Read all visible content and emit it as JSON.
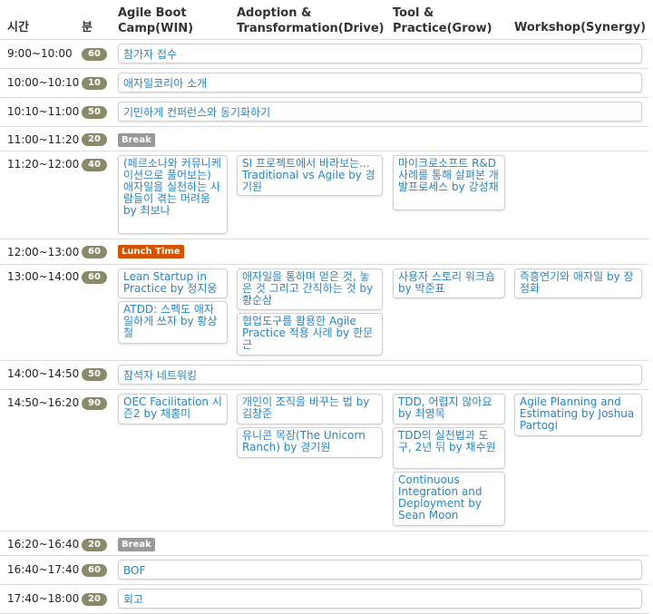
{
  "colors": {
    "badge": "#8a8a6a",
    "link": "#2a85c2",
    "break_tag": "#999999",
    "lunch_tag": "#d35400",
    "border": "#d0d0d0"
  },
  "header": {
    "time": "시간",
    "minutes": "분",
    "tracks": [
      "Agile Boot\nCamp(WIN)",
      "Adoption &\nTransformation(Drive)",
      "Tool &\nPractice(Grow)",
      "Workshop(Synergy)"
    ]
  },
  "rows": [
    {
      "time": "9:00~10:00",
      "min": "60",
      "text": "참가자 접수"
    },
    {
      "time": "10:00~10:10",
      "min": "10",
      "text": "애자일코리아 소개"
    },
    {
      "time": "10:10~11:00",
      "min": "50",
      "text": "기민하게 컨퍼런스와 동기화하기"
    },
    {
      "time": "11:00~11:20",
      "min": "20",
      "tag": "Break"
    },
    {
      "time": "11:20~12:00",
      "min": "40",
      "s1": "(페르소나와 커뮤니케이션으로 풀어보는) 애자일을 실천하는 사람들이 겪는 머려움 by 최보나",
      "s2": "SI 프로젝트에서 바라보는... Traditional vs Agile by 경기원",
      "s3": "마이크로소프트 R&D 사례를 통해 살펴본 개발프로세스 by 강성채"
    },
    {
      "time": "12:00~13:00",
      "min": "60",
      "tag": "Lunch Time"
    },
    {
      "time": "13:00~14:00",
      "min": "60",
      "s1a": "Lean Startup in Practice by 정지웅",
      "s1b": "ATDD: 스펙도 애자일하게 쓰자 by 황상철",
      "s2a": "애자일을 통하며 얻은 것, 놓은 것 그리고 간직하는 것 by 황순삼",
      "s2b": "협업도구를 활용한 Agile Practice 적용 사례 by 한문근",
      "s3": "사용자 스토리 워크숍 by 박준표",
      "s4": "즉흥연기와 애자일 by 장정화"
    },
    {
      "time": "14:00~14:50",
      "min": "50",
      "text": "참석자 네트워킹"
    },
    {
      "time": "14:50~16:20",
      "min": "90",
      "s1": "OEC Facilitation 시즌2 by 채홍미",
      "s2a": "개인이 조직을 바꾸는 법 by 김창준",
      "s2b": "유니콘 목장(The Unicorn Ranch) by 경기원",
      "s3a": "TDD, 어렵지 않아요 by 최영목",
      "s3b": "TDD의 실천법과 도구, 2년 뒤 by 채수원",
      "s3c": "Continuous Integration and Deployment by Sean Moon",
      "s4": "Agile Planning and Estimating by Joshua Partogi"
    },
    {
      "time": "16:20~16:40",
      "min": "20",
      "tag": "Break"
    },
    {
      "time": "16:40~17:40",
      "min": "60",
      "text": "BOF"
    },
    {
      "time": "17:40~18:00",
      "min": "20",
      "text": "회고"
    }
  ]
}
